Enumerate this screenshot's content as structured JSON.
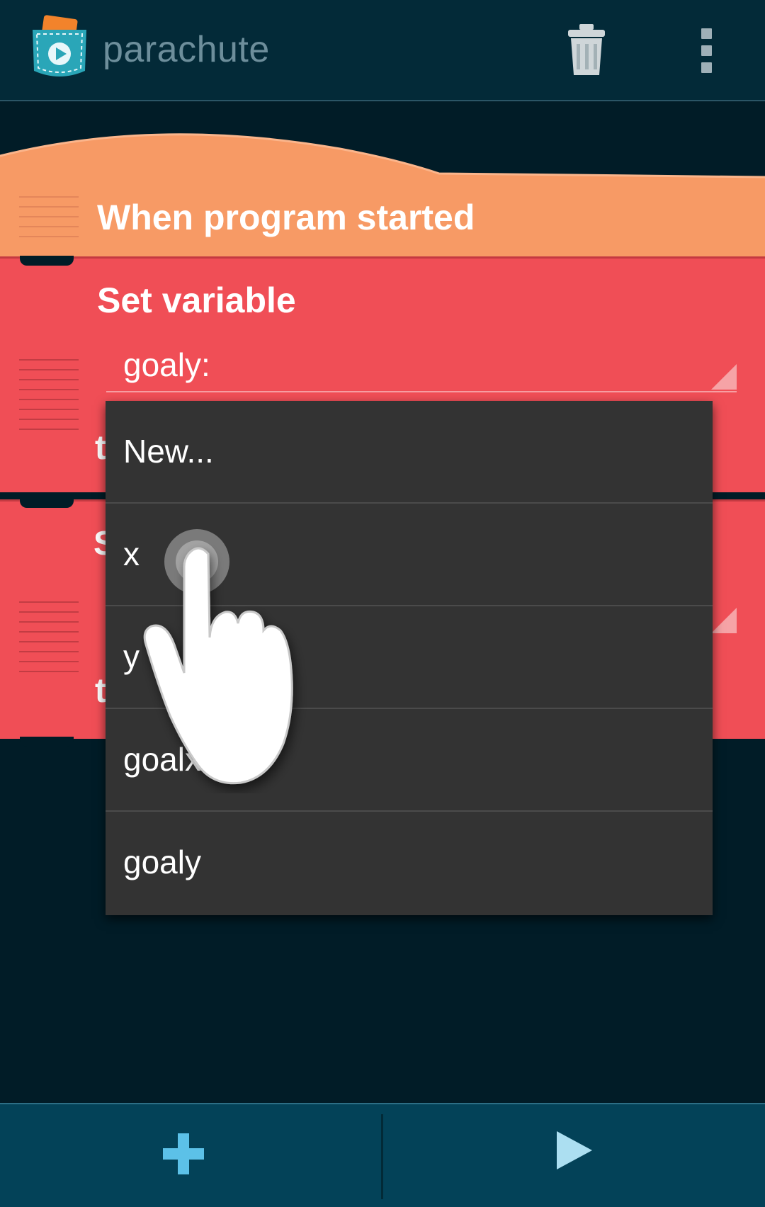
{
  "app": {
    "title": "parachute"
  },
  "toolbar": {
    "delete_icon": "trash-icon",
    "overflow_icon": "overflow-menu-icon"
  },
  "script": {
    "hat_block": "When program started",
    "set_block_title": "Set variable",
    "selected_variable": "goaly:",
    "peek_letters": [
      "t",
      "S",
      "t"
    ]
  },
  "dropdown": {
    "options": [
      "New...",
      "x",
      "y",
      "goalx",
      "goaly"
    ]
  },
  "bottom_bar": {
    "add_icon": "plus-icon",
    "play_icon": "play-icon"
  },
  "colors": {
    "hat_block": "#f79a65",
    "set_block": "#f04e56",
    "background": "#011c27",
    "accent": "#5cc1e8"
  }
}
